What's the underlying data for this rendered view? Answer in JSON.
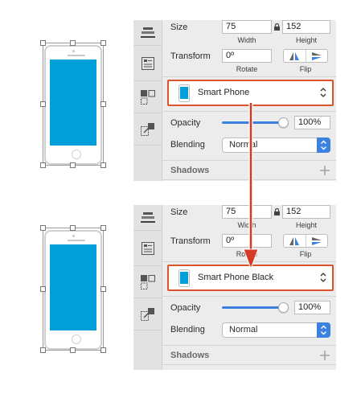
{
  "before": {
    "size_label": "Size",
    "width_value": "75",
    "width_label": "Width",
    "height_value": "152",
    "height_label": "Height",
    "transform_label": "Transform",
    "rotate_value": "0º",
    "rotate_label": "Rotate",
    "flip_label": "Flip",
    "symbol_name": "Smart Phone",
    "opacity_label": "Opacity",
    "opacity_value": "100%",
    "blending_label": "Blending",
    "blending_value": "Normal",
    "shadows_label": "Shadows"
  },
  "after": {
    "size_label": "Size",
    "width_value": "75",
    "width_label": "Width",
    "height_value": "152",
    "height_label": "Height",
    "transform_label": "Transform",
    "rotate_value": "0º",
    "rotate_label": "Rotate",
    "flip_label": "Flip",
    "symbol_name": "Smart Phone Black",
    "opacity_label": "Opacity",
    "opacity_value": "100%",
    "blending_label": "Blending",
    "blending_value": "Normal",
    "shadows_label": "Shadows"
  },
  "colors": {
    "phone_screen": "#009fd9",
    "highlight": "#d9542b",
    "arrow": "#d63a24",
    "accent": "#3b82e0"
  },
  "icons": [
    "align-icon",
    "style-icon",
    "symbol-icon",
    "export-icon",
    "flip-horizontal-icon",
    "flip-vertical-icon",
    "lock-icon",
    "chevron-updown-icon",
    "plus-icon",
    "arrow-icon"
  ],
  "opacity_level": 1.0
}
